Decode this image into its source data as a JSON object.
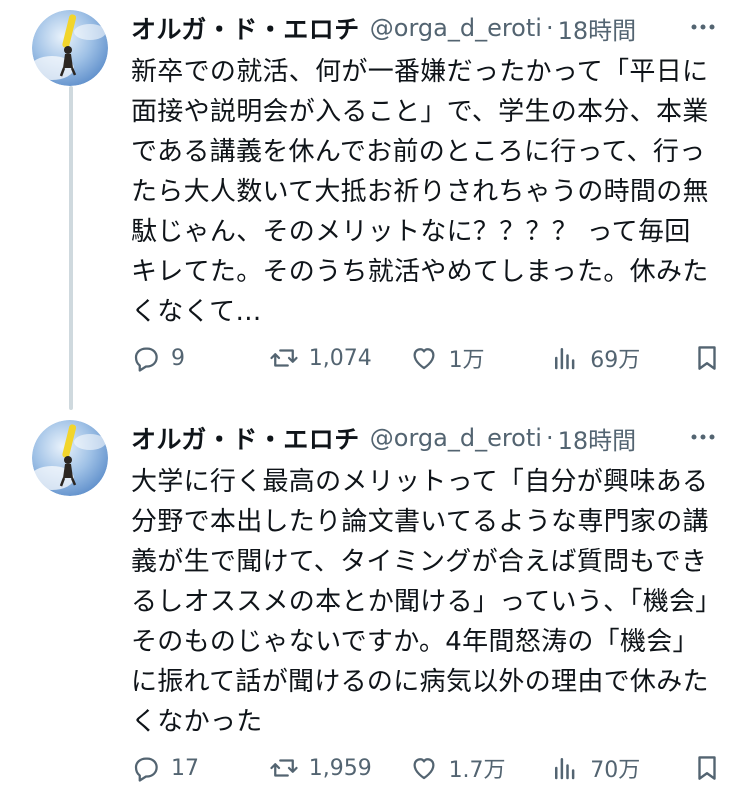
{
  "tweets": [
    {
      "display_name": "オルガ・ド・エロチ",
      "handle": "@orga_d_eroti",
      "separator": "·",
      "time": "18時間",
      "text": "新卒での就活、何が一番嫌だったかって「平日に面接や説明会が入ること」で、学生の本分、本業である講義を休んでお前のところに行って、行ったら大人数いて大抵お祈りされちゃうの時間の無駄じゃん、そのメリットなに？？？？ って毎回キレてた。そのうち就活やめてしまった。休みたくなくて…",
      "replies": "9",
      "retweets": "1,074",
      "likes": "1万",
      "views": "69万"
    },
    {
      "display_name": "オルガ・ド・エロチ",
      "handle": "@orga_d_eroti",
      "separator": "·",
      "time": "18時間",
      "text": "大学に行く最高のメリットって「自分が興味ある分野で本出したり論文書いてるような専門家の講義が生で聞けて、タイミングが合えば質問もできるしオススメの本とか聞ける」っていう、「機会」そのものじゃないですか。4年間怒涛の「機会」に振れて話が聞けるのに病気以外の理由で休みたくなかった",
      "replies": "17",
      "retweets": "1,959",
      "likes": "1.7万",
      "views": "70万"
    }
  ],
  "colors": {
    "text": "#0f1419",
    "secondary": "#536471",
    "thread_line": "#cfd9de"
  },
  "icons": [
    "reply-icon",
    "retweet-icon",
    "like-icon",
    "views-icon",
    "bookmark-icon",
    "more-icon"
  ]
}
